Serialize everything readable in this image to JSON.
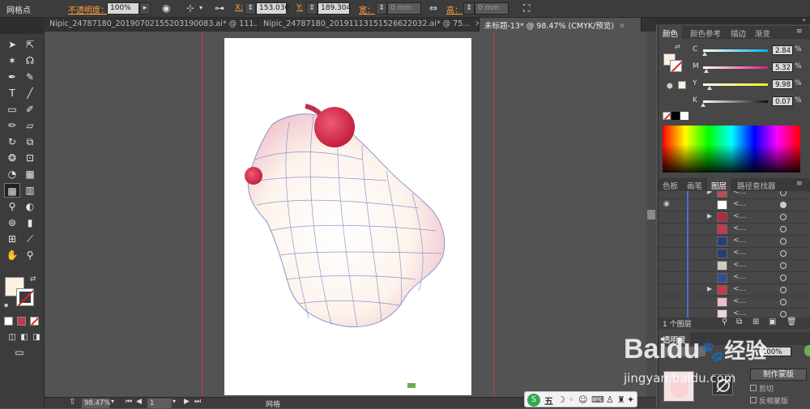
{
  "control_bar": {
    "tool_name": "网格点",
    "opacity_label": "不透明度：",
    "opacity_value": "100%",
    "x_label": "X:",
    "x_value": "153.036",
    "y_label": "Y:",
    "y_value": "189.304",
    "w_label": "宽：",
    "w_value": "0 mm",
    "h_label": "高：",
    "h_value": "0 mm"
  },
  "document_tabs": [
    {
      "label": "Nipic_24787180_20190702155203190083.ai* @ 111..."
    },
    {
      "label": "Nipic_24787180_20191113151526622032.ai* @ 75..."
    },
    {
      "label": "未标题-13* @ 98.47% (CMYK/预览)"
    }
  ],
  "color_panel": {
    "tabs": [
      "颜色",
      "颜色参考",
      "描边",
      "渐变"
    ],
    "channels": [
      {
        "name": "C",
        "value": "2.84",
        "pct": 0.0284,
        "color": "#00b6e8"
      },
      {
        "name": "M",
        "value": "5.32",
        "pct": 0.0532,
        "color": "#e8157a"
      },
      {
        "name": "Y",
        "value": "9.98",
        "pct": 0.0998,
        "color": "#f7ec13"
      },
      {
        "name": "K",
        "value": "0.07",
        "pct": 0.0007,
        "color": "#111111"
      }
    ],
    "fill_color": "#fbf1e3"
  },
  "layers_panel": {
    "tabs": [
      "色板",
      "画笔",
      "图层",
      "路径查找器"
    ],
    "row_label": "<...",
    "footer_text": "1 个图层",
    "row_colors": [
      "#c04a5a",
      "#ffffff",
      "#b8283a",
      "#c43a4a",
      "#2a3c78",
      "#2a3c78",
      "#d4c8c8",
      "#3a4a90",
      "#c43a4a",
      "#e7c0c8",
      "#f0d4d8",
      "#d2aab5"
    ]
  },
  "transparency_panel": {
    "tab": "透明度",
    "opacity_value": "100%",
    "make_mask_button": "制作蒙版",
    "clip_label": "剪切",
    "invert_mask_label": "反相蒙版"
  },
  "status_bar": {
    "zoom": "98.47%",
    "page": "1",
    "tool_label": "网格"
  },
  "watermark": {
    "brand": "Baidu",
    "suffix": "经验",
    "url": "jingyan.baidu.com"
  },
  "taskbar": {
    "ime_label": "五"
  }
}
